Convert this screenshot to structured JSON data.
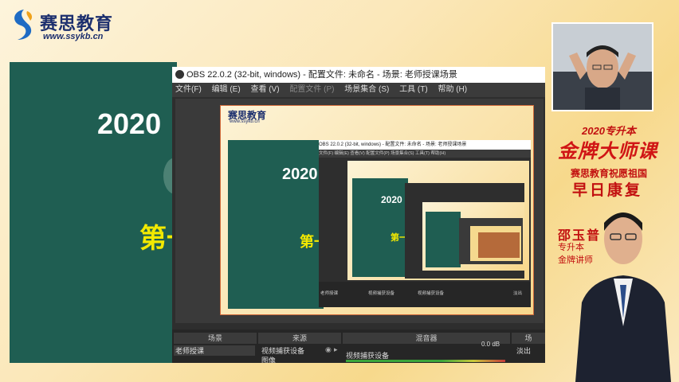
{
  "brand": {
    "name": "赛思教育",
    "url": "www.ssykb.cn"
  },
  "slide": {
    "title": "2020",
    "subtitle": "第一"
  },
  "obs": {
    "title": "OBS 22.0.2 (32-bit, windows) - 配置文件: 未命名 - 场景: 老师授课场景",
    "menu": [
      {
        "label": "文件(F)",
        "enabled": true
      },
      {
        "label": "编辑 (E)",
        "enabled": true
      },
      {
        "label": "查看 (V)",
        "enabled": true
      },
      {
        "label": "配置文件 (P)",
        "enabled": false
      },
      {
        "label": "场景集合 (S)",
        "enabled": true
      },
      {
        "label": "工具 (T)",
        "enabled": true
      },
      {
        "label": "帮助 (H)",
        "enabled": true
      }
    ],
    "docks": {
      "scenes_header": "场景",
      "sources_header": "来源",
      "mixer_header": "混音器",
      "transitions_header": "场",
      "scene_item": "老师授课",
      "source_items": [
        "视频捕获设备",
        "图像"
      ],
      "mixer_item": "视频捕获设备",
      "mixer_db": "0.0 dB",
      "transition_item": "淡出"
    },
    "nested": {
      "title": "OBS 22.0.2 (32-bit, windows) - 配置文件: 未命名 - 场景: 老师授课场景",
      "menu": "文件(F)  编辑(E)  查看(V)  配置文件(P)  场景集合(S)  工具(T)  帮助(H)",
      "slide_title": "2020",
      "slide_sub": "第一",
      "scene_item": "老师授课",
      "source_item": "视频捕获设备",
      "mixer_item": "视频捕获设备",
      "transition_item": "淡出"
    }
  },
  "promo": {
    "line1": "2020专升本",
    "line2": "金牌大师课",
    "line3": "赛思教育祝愿祖国",
    "line4": "早日康复"
  },
  "teacher": {
    "name": "邵玉普",
    "title1": "专升本",
    "title2": "金牌讲师"
  },
  "colors": {
    "slide_green": "#1f5e52",
    "promo_red": "#d01515",
    "brand_navy": "#1c2f6e",
    "subtitle_yellow": "#f3e900"
  }
}
